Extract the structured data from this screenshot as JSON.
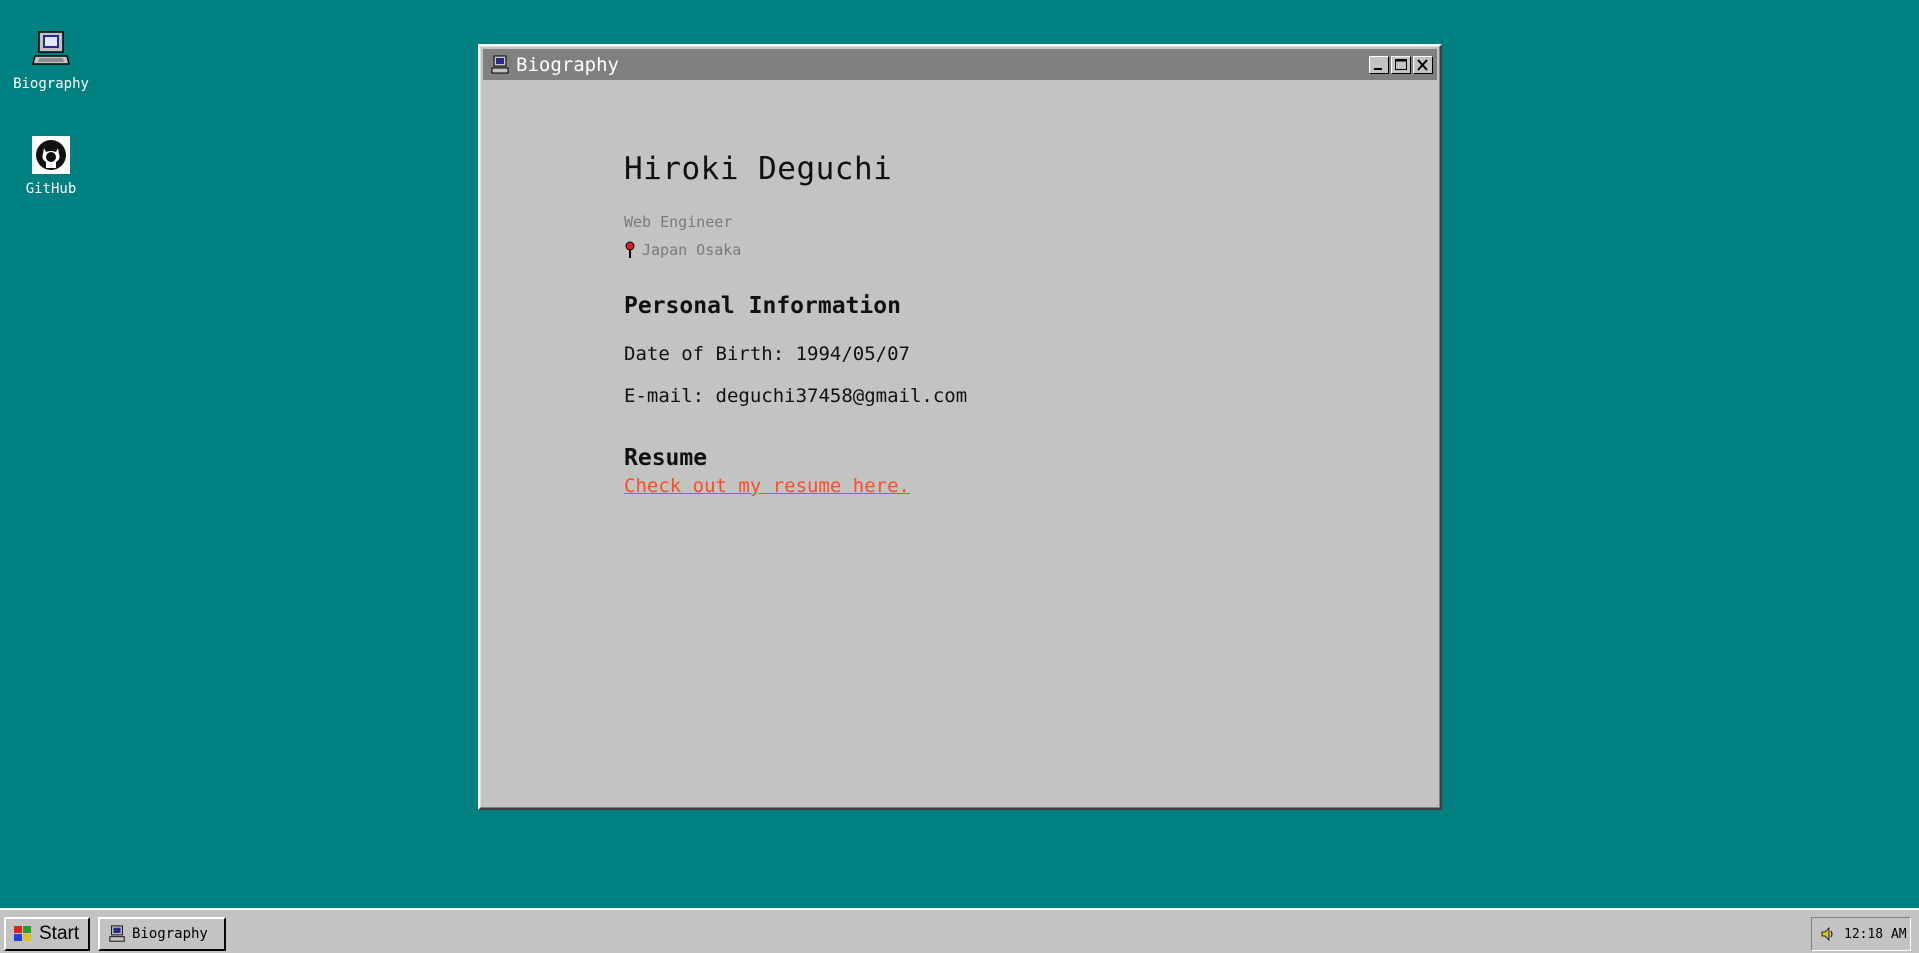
{
  "desktop": {
    "icons": [
      {
        "label": "Biography",
        "icon": "computer-icon"
      },
      {
        "label": "GitHub",
        "icon": "github-icon"
      }
    ]
  },
  "window": {
    "title": "Biography",
    "buttons": [
      "minimize",
      "maximize",
      "close"
    ]
  },
  "profile": {
    "name": "Hiroki Deguchi",
    "role": "Web Engineer",
    "location": "Japan Osaka",
    "personal_heading": "Personal Information",
    "dob": "Date of Birth: 1994/05/07",
    "email": "E-mail: deguchi37458@gmail.com",
    "resume_heading": "Resume",
    "resume_link": "Check out my resume here."
  },
  "taskbar": {
    "start_label": "Start",
    "task_label": "Biography",
    "clock": "12:18 AM"
  },
  "colors": {
    "desktop": "#008080",
    "window_bg": "#c3c3c3",
    "titlebar": "#808080",
    "link": "#ff4a26"
  }
}
